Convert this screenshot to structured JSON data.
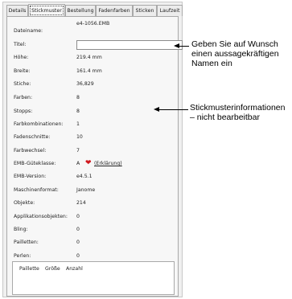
{
  "tabs": [
    {
      "label": "Details"
    },
    {
      "label": "Stickmuster"
    },
    {
      "label": "Bestellung"
    },
    {
      "label": "Fadenfarben"
    },
    {
      "label": "Sticken"
    },
    {
      "label": "Laufzeit"
    }
  ],
  "fields": {
    "dateiname": {
      "label": "Dateiname:",
      "value": "e4-1056.EMB"
    },
    "titel": {
      "label": "Titel:",
      "value": ""
    },
    "hoehe": {
      "label": "Höhe:",
      "value": "219.4 mm"
    },
    "breite": {
      "label": "Breite:",
      "value": "161.4 mm"
    },
    "stiche": {
      "label": "Stiche:",
      "value": "36,829"
    },
    "farben": {
      "label": "Farben:",
      "value": "8"
    },
    "stopps": {
      "label": "Stopps:",
      "value": "8"
    },
    "farbkombinationen": {
      "label": "Farbkombinationen:",
      "value": "1"
    },
    "fadenschnitte": {
      "label": "Fadenschnitte:",
      "value": "10"
    },
    "farbwechsel": {
      "label": "Farbwechsel:",
      "value": "7"
    },
    "guteklasse": {
      "label": "EMB-Güteklasse:",
      "value": "A",
      "link": "(Erklärung)"
    },
    "version": {
      "label": "EMB-Version:",
      "value": "e4.5.1"
    },
    "maschinenformat": {
      "label": "Maschinenformat:",
      "value": "Janome"
    },
    "objekte": {
      "label": "Objekte:",
      "value": "214"
    },
    "applikationsobjekten": {
      "label": "Applikationsobjekten:",
      "value": "0"
    },
    "bling": {
      "label": "Bling:",
      "value": "0"
    },
    "pailletten": {
      "label": "Pailletten:",
      "value": "0"
    },
    "perlen": {
      "label": "Perlen:",
      "value": "0"
    }
  },
  "list": {
    "columns": [
      "Paillette",
      "Größe",
      "Anzahl"
    ]
  },
  "callouts": {
    "title_hint": [
      "Geben Sie auf Wunsch",
      "einen aussagekräftigen",
      "Namen ein"
    ],
    "info_hint": [
      "Stickmusterinformationen",
      "– nicht bearbeitbar"
    ]
  },
  "colors": {
    "heart": "#d0161c"
  }
}
